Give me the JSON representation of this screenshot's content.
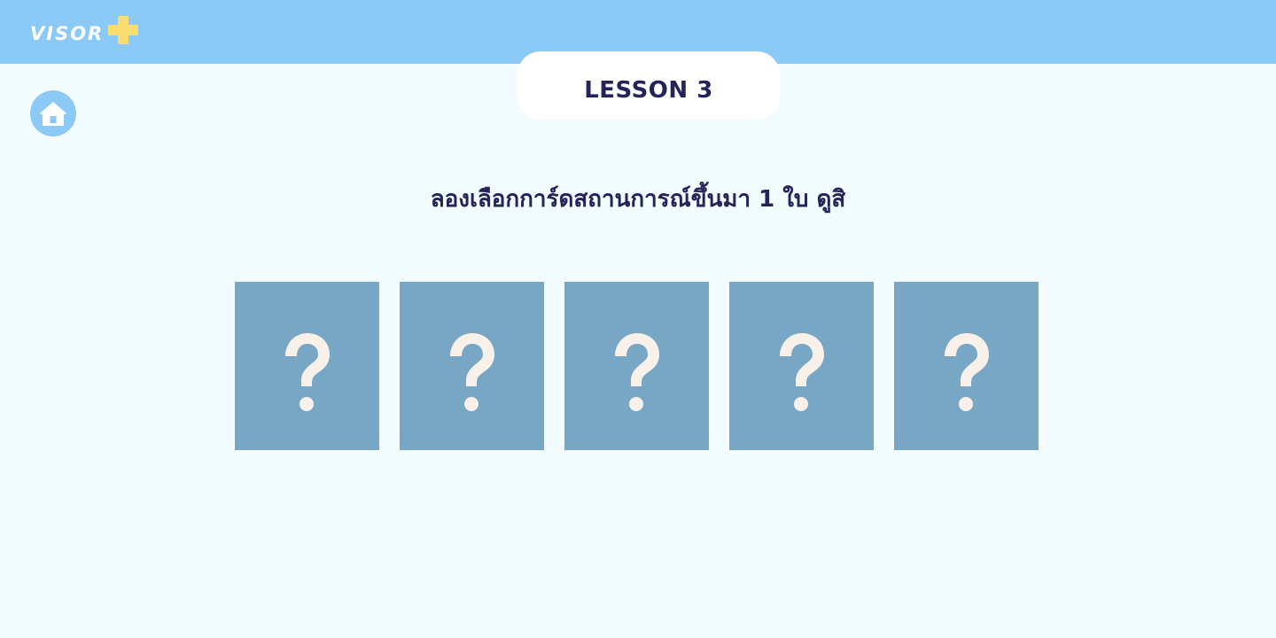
{
  "header": {
    "logo_text": "VISOR",
    "logo_icon": "plus-icon",
    "background_color": "#8bc9f6",
    "logo_plus_color": "#f9dd6e"
  },
  "lesson": {
    "title": "LESSON 3"
  },
  "nav": {
    "home_icon": "home-icon"
  },
  "instruction": {
    "text": "ลองเลือกการ์ดสถานการณ์ขึ้นมา 1 ใบ ดูสิ"
  },
  "cards": [
    {
      "icon": "question-mark-icon"
    },
    {
      "icon": "question-mark-icon"
    },
    {
      "icon": "question-mark-icon"
    },
    {
      "icon": "question-mark-icon"
    },
    {
      "icon": "question-mark-icon"
    }
  ],
  "colors": {
    "page_background": "#f2fbfd",
    "card_background": "#78a7c5",
    "card_symbol": "#f8f1ea",
    "title_text": "#24245a"
  }
}
